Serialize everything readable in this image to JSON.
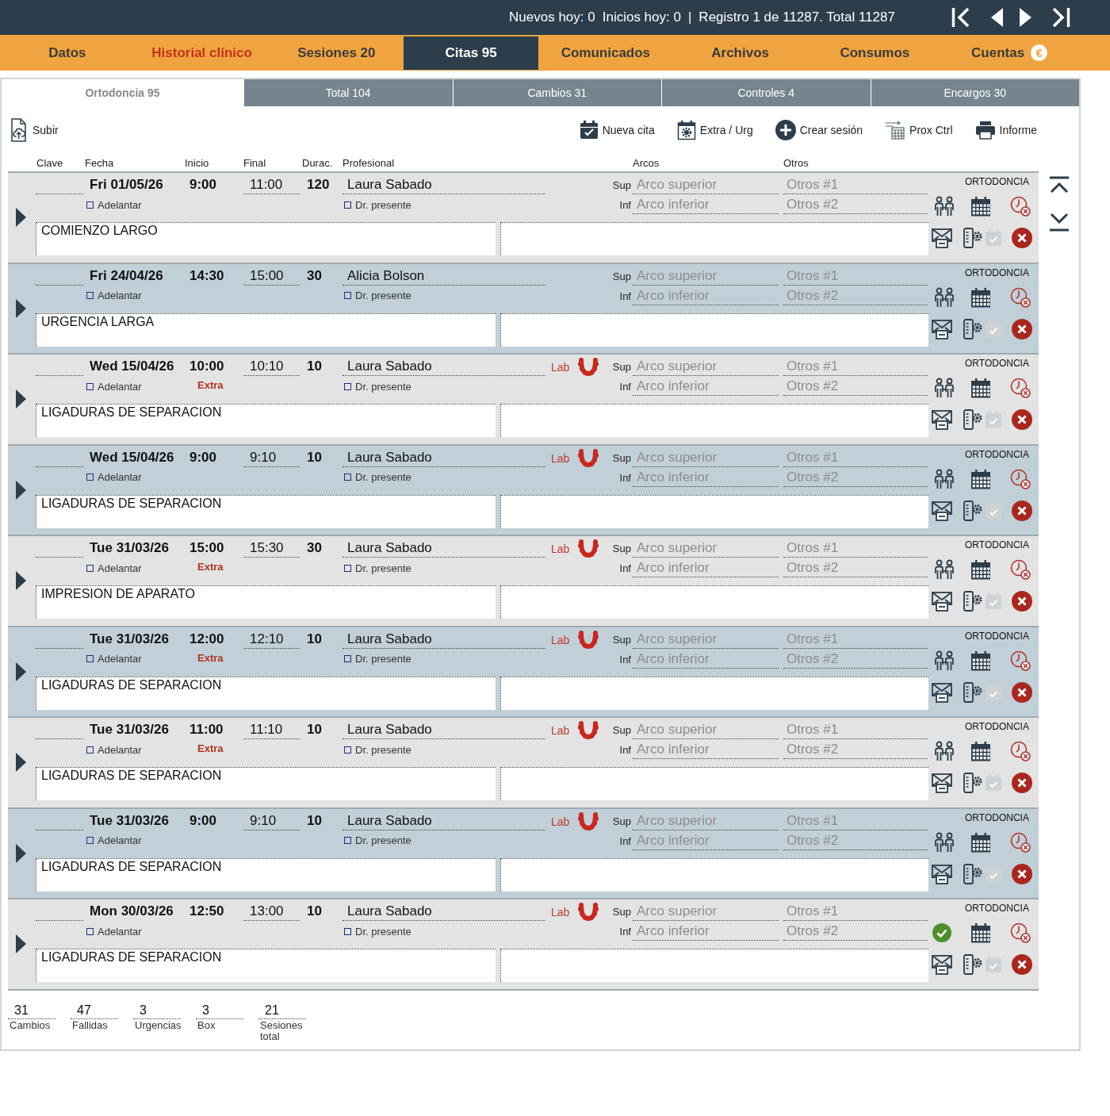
{
  "top_bar": {
    "new_today": "Nuevos hoy: 0",
    "starts_today": "Inicios hoy: 0",
    "separator": "|",
    "record": "Registro 1 de 11287. Total 11287"
  },
  "main_tabs": [
    {
      "label": "Datos",
      "selected": false,
      "highlighted": false
    },
    {
      "label": "Historial clínico",
      "selected": false,
      "highlighted": true
    },
    {
      "label": "Sesiones 20",
      "selected": false,
      "highlighted": false
    },
    {
      "label": "Citas 95",
      "selected": true,
      "highlighted": false
    },
    {
      "label": "Comunicados",
      "selected": false,
      "highlighted": false
    },
    {
      "label": "Archivos",
      "selected": false,
      "highlighted": false
    },
    {
      "label": "Consumos",
      "selected": false,
      "highlighted": false
    },
    {
      "label": "Cuentas",
      "selected": false,
      "highlighted": false,
      "badge": "€"
    }
  ],
  "sub_tabs": [
    {
      "label": "Ortodoncia 95",
      "selected": true
    },
    {
      "label": "Total 104",
      "selected": false
    },
    {
      "label": "Cambios 31",
      "selected": false
    },
    {
      "label": "Controles 4",
      "selected": false
    },
    {
      "label": "Encargos 30",
      "selected": false
    }
  ],
  "toolbar": [
    {
      "kind": "upload",
      "label": "Subir"
    },
    {
      "kind": "new",
      "label": "Nueva cita"
    },
    {
      "kind": "extra",
      "label": "Extra / Urg"
    },
    {
      "kind": "session",
      "label": "Crear sesión"
    },
    {
      "kind": "control",
      "label": "Prox Ctrl"
    },
    {
      "kind": "report",
      "label": "Informe"
    }
  ],
  "columns": [
    "Clave",
    "Fecha",
    "Inicio",
    "Final",
    "Durac.",
    "Profesional",
    "Arcos",
    "Otros"
  ],
  "appointments": [
    {
      "date": "Fri 01/05/26",
      "start": "9:00",
      "end": "11:00",
      "duration": "120",
      "professional": "Laura Sabado",
      "advance": {
        "label": "Adelantar",
        "checked": false
      },
      "doctor_present": {
        "label": "Dr. presente",
        "checked": false
      },
      "arch_upper": {
        "label": "Sup",
        "placeholder": "Arco superior"
      },
      "arch_lower": {
        "label": "Inf",
        "placeholder": "Arco inferior"
      },
      "other_1": {
        "placeholder": "Otros #1"
      },
      "other_2": {
        "placeholder": "Otros #2"
      },
      "treatment": "ORTODONCIA",
      "notes": "COMIENZO LARGO",
      "attended": false
    },
    {
      "date": "Fri 24/04/26",
      "start": "14:30",
      "end": "15:00",
      "duration": "30",
      "professional": "Alicia Bolson",
      "advance": {
        "label": "Adelantar",
        "checked": false
      },
      "doctor_present": {
        "label": "Dr. presente",
        "checked": false
      },
      "arch_upper": {
        "label": "Sup",
        "placeholder": "Arco superior"
      },
      "arch_lower": {
        "label": "Inf",
        "placeholder": "Arco inferior"
      },
      "other_1": {
        "placeholder": "Otros #1"
      },
      "other_2": {
        "placeholder": "Otros #2"
      },
      "treatment": "ORTODONCIA",
      "notes": "URGENCIA LARGA",
      "attended": false
    },
    {
      "date": "Wed 15/04/26",
      "start": "10:00",
      "end": "10:10",
      "duration": "10",
      "professional": "Laura Sabado",
      "lab": "Lab",
      "extra": "Extra",
      "advance": {
        "label": "Adelantar",
        "checked": false
      },
      "doctor_present": {
        "label": "Dr. presente",
        "checked": false
      },
      "arch_upper": {
        "label": "Sup",
        "placeholder": "Arco superior"
      },
      "arch_lower": {
        "label": "Inf",
        "placeholder": "Arco inferior"
      },
      "other_1": {
        "placeholder": "Otros #1"
      },
      "other_2": {
        "placeholder": "Otros #2"
      },
      "treatment": "ORTODONCIA",
      "notes": "LIGADURAS DE SEPARACION",
      "attended": false
    },
    {
      "date": "Wed 15/04/26",
      "start": "9:00",
      "end": "9:10",
      "duration": "10",
      "professional": "Laura Sabado",
      "lab": "Lab",
      "advance": {
        "label": "Adelantar",
        "checked": false
      },
      "doctor_present": {
        "label": "Dr. presente",
        "checked": false
      },
      "arch_upper": {
        "label": "Sup",
        "placeholder": "Arco superior"
      },
      "arch_lower": {
        "label": "Inf",
        "placeholder": "Arco inferior"
      },
      "other_1": {
        "placeholder": "Otros #1"
      },
      "other_2": {
        "placeholder": "Otros #2"
      },
      "treatment": "ORTODONCIA",
      "notes": "LIGADURAS DE SEPARACION",
      "attended": false
    },
    {
      "date": "Tue 31/03/26",
      "start": "15:00",
      "end": "15:30",
      "duration": "30",
      "professional": "Laura Sabado",
      "lab": "Lab",
      "extra": "Extra",
      "advance": {
        "label": "Adelantar",
        "checked": false
      },
      "doctor_present": {
        "label": "Dr. presente",
        "checked": false
      },
      "arch_upper": {
        "label": "Sup",
        "placeholder": "Arco superior"
      },
      "arch_lower": {
        "label": "Inf",
        "placeholder": "Arco inferior"
      },
      "other_1": {
        "placeholder": "Otros #1"
      },
      "other_2": {
        "placeholder": "Otros #2"
      },
      "treatment": "ORTODONCIA",
      "notes": "IMPRESION DE APARATO",
      "attended": false
    },
    {
      "date": "Tue 31/03/26",
      "start": "12:00",
      "end": "12:10",
      "duration": "10",
      "professional": "Laura Sabado",
      "lab": "Lab",
      "extra": "Extra",
      "advance": {
        "label": "Adelantar",
        "checked": false
      },
      "doctor_present": {
        "label": "Dr. presente",
        "checked": false
      },
      "arch_upper": {
        "label": "Sup",
        "placeholder": "Arco superior"
      },
      "arch_lower": {
        "label": "Inf",
        "placeholder": "Arco inferior"
      },
      "other_1": {
        "placeholder": "Otros #1"
      },
      "other_2": {
        "placeholder": "Otros #2"
      },
      "treatment": "ORTODONCIA",
      "notes": "LIGADURAS DE SEPARACION",
      "attended": false
    },
    {
      "date": "Tue 31/03/26",
      "start": "11:00",
      "end": "11:10",
      "duration": "10",
      "professional": "Laura Sabado",
      "lab": "Lab",
      "extra": "Extra",
      "advance": {
        "label": "Adelantar",
        "checked": false
      },
      "doctor_present": {
        "label": "Dr. presente",
        "checked": false
      },
      "arch_upper": {
        "label": "Sup",
        "placeholder": "Arco superior"
      },
      "arch_lower": {
        "label": "Inf",
        "placeholder": "Arco inferior"
      },
      "other_1": {
        "placeholder": "Otros #1"
      },
      "other_2": {
        "placeholder": "Otros #2"
      },
      "treatment": "ORTODONCIA",
      "notes": "LIGADURAS DE SEPARACION",
      "attended": false
    },
    {
      "date": "Tue 31/03/26",
      "start": "9:00",
      "end": "9:10",
      "duration": "10",
      "professional": "Laura Sabado",
      "lab": "Lab",
      "advance": {
        "label": "Adelantar",
        "checked": false
      },
      "doctor_present": {
        "label": "Dr. presente",
        "checked": false
      },
      "arch_upper": {
        "label": "Sup",
        "placeholder": "Arco superior"
      },
      "arch_lower": {
        "label": "Inf",
        "placeholder": "Arco inferior"
      },
      "other_1": {
        "placeholder": "Otros #1"
      },
      "other_2": {
        "placeholder": "Otros #2"
      },
      "treatment": "ORTODONCIA",
      "notes": "LIGADURAS DE SEPARACION",
      "attended": false
    },
    {
      "date": "Mon 30/03/26",
      "start": "12:50",
      "end": "13:00",
      "duration": "10",
      "professional": "Laura Sabado",
      "lab": "Lab",
      "advance": {
        "label": "Adelantar",
        "checked": false
      },
      "doctor_present": {
        "label": "Dr. presente",
        "checked": false
      },
      "arch_upper": {
        "label": "Sup",
        "placeholder": "Arco superior"
      },
      "arch_lower": {
        "label": "Inf",
        "placeholder": "Arco inferior"
      },
      "other_1": {
        "placeholder": "Otros #1"
      },
      "other_2": {
        "placeholder": "Otros #2"
      },
      "treatment": "ORTODONCIA",
      "notes": "LIGADURAS DE SEPARACION",
      "attended": true
    }
  ],
  "summary": [
    {
      "value": "31",
      "label": "Cambios"
    },
    {
      "value": "47",
      "label": "Fallidas"
    },
    {
      "value": "3",
      "label": "Urgencias"
    },
    {
      "value": "3",
      "label": "Box"
    },
    {
      "value": "21",
      "label": "Sesiones total"
    }
  ]
}
